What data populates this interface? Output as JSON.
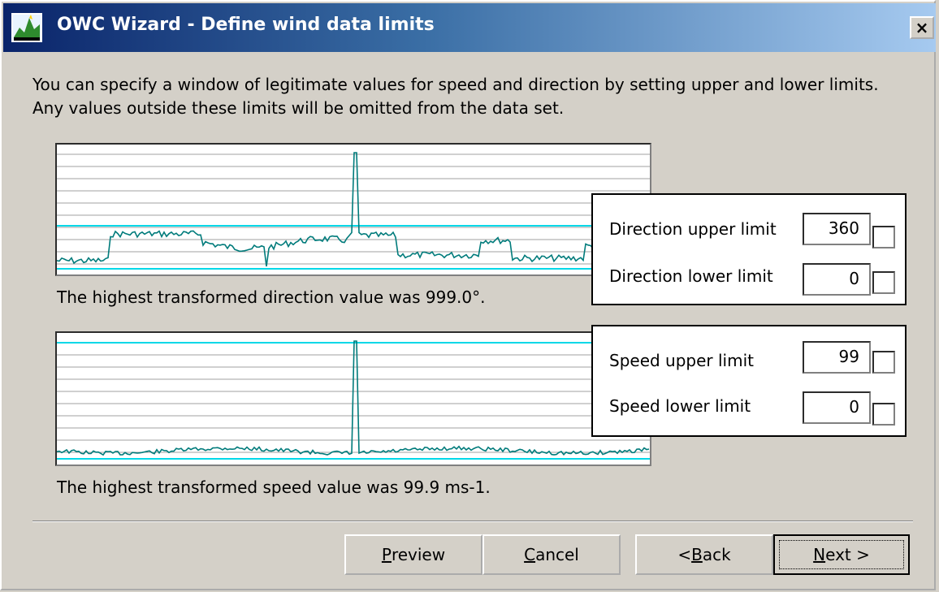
{
  "window": {
    "title": "OWC Wizard - Define wind data limits",
    "close_label": "×",
    "title_gradient": [
      "#0a246a",
      "#a6caf0"
    ]
  },
  "intro": {
    "text": "You can specify a window of legitimate values for speed and direction by setting upper and lower limits. Any values outside these limits will be omitted from the data set."
  },
  "direction": {
    "caption": "The highest transformed direction value was 999.0°.",
    "upper_label": "Direction upper limit",
    "upper_value": "360",
    "upper_checked": false,
    "lower_label": "Direction lower limit",
    "lower_value": "0",
    "lower_checked": false,
    "plot_limits": {
      "upper": 360,
      "lower": 0,
      "max": 999.0
    }
  },
  "speed": {
    "caption": "The highest transformed speed value was 99.9 ms-1.",
    "upper_label": "Speed upper limit",
    "upper_value": "99",
    "upper_checked": false,
    "lower_label": "Speed lower limit",
    "lower_value": "0",
    "lower_checked": false,
    "plot_limits": {
      "upper": 99,
      "lower": 0,
      "max": 99.9
    }
  },
  "buttons": {
    "preview": {
      "pre": "",
      "key": "P",
      "post": "review"
    },
    "cancel": {
      "pre": "",
      "key": "C",
      "post": "ancel"
    },
    "back": {
      "pre": "< ",
      "key": "B",
      "post": "ack"
    },
    "next": {
      "pre": "",
      "key": "N",
      "post": "ext >"
    }
  },
  "colors": {
    "series": "#007b7b",
    "limit_line": "#00d8e8",
    "grid": "#a0a0a0",
    "face": "#d4d0c8"
  }
}
